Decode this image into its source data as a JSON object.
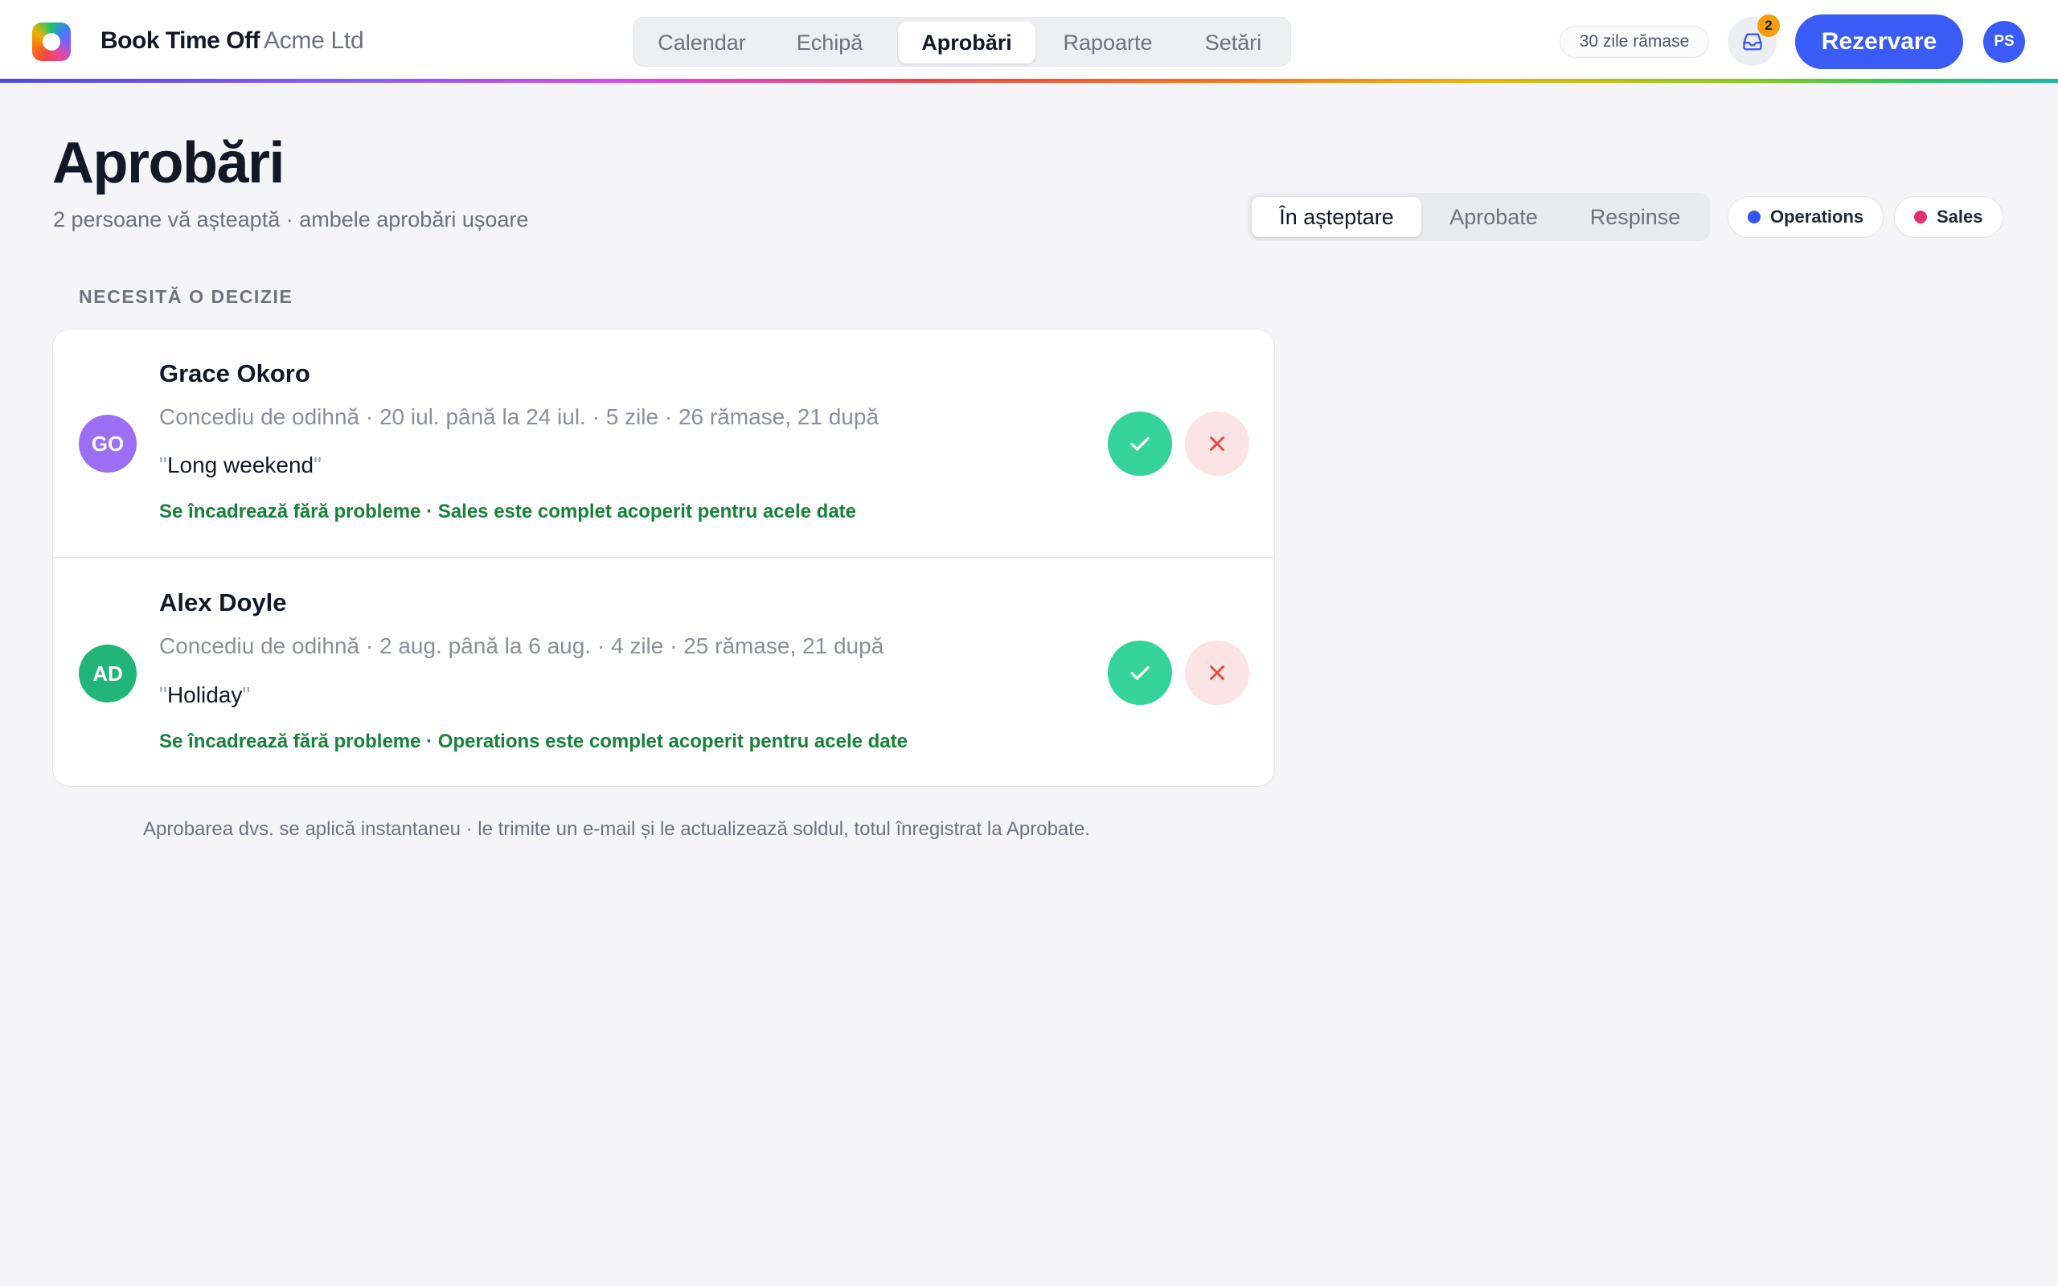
{
  "app": {
    "brand": "Book Time Off",
    "company": "Acme Ltd"
  },
  "nav": {
    "items": [
      {
        "label": "Calendar"
      },
      {
        "label": "Echipă"
      },
      {
        "label": "Aprobări",
        "active": true
      },
      {
        "label": "Rapoarte"
      },
      {
        "label": "Setări"
      }
    ]
  },
  "header": {
    "days_remaining": "30 zile rămase",
    "inbox_icon": "inbox-icon",
    "inbox_count": "2",
    "book_label": "Rezervare",
    "user_initials": "PS"
  },
  "page": {
    "title": "Aprobări",
    "subtitle": "2 persoane vă așteaptă · ambele aprobări ușoare"
  },
  "status_tabs": [
    {
      "label": "În așteptare",
      "active": true
    },
    {
      "label": "Aprobate"
    },
    {
      "label": "Respinse"
    }
  ],
  "teams": [
    {
      "label": "Operations",
      "color": "#3355f2"
    },
    {
      "label": "Sales",
      "color": "#e0306f"
    }
  ],
  "section_label": "NECESITĂ O DECIZIE",
  "requests": [
    {
      "initials": "GO",
      "avatar_color": "#9b6ef3",
      "name": "Grace Okoro",
      "details": "Concediu de odihnă · 20 iul. până la 24 iul. · 5 zile · 26 rămase, 21 după",
      "note": "Long weekend",
      "status": "Se încadrează fără probleme · Sales este complet acoperit pentru acele date"
    },
    {
      "initials": "AD",
      "avatar_color": "#22b57a",
      "name": "Alex Doyle",
      "details": "Concediu de odihnă · 2 aug. până la 6 aug. · 4 zile · 25 rămase, 21 după",
      "note": "Holiday",
      "status": "Se încadrează fără probleme · Operations este complet acoperit pentru acele date"
    }
  ],
  "footer_note": "Aprobarea dvs. se aplică instantaneu · le trimite un e-mail și le actualizează soldul, totul înregistrat la Aprobate.",
  "colors": {
    "accent": "#3b5bf6",
    "approve": "#34d399",
    "reject_bg": "#fde4e4",
    "reject_icon": "#e14b4b",
    "status_ok": "#16823a",
    "badge": "#f59e0b"
  }
}
